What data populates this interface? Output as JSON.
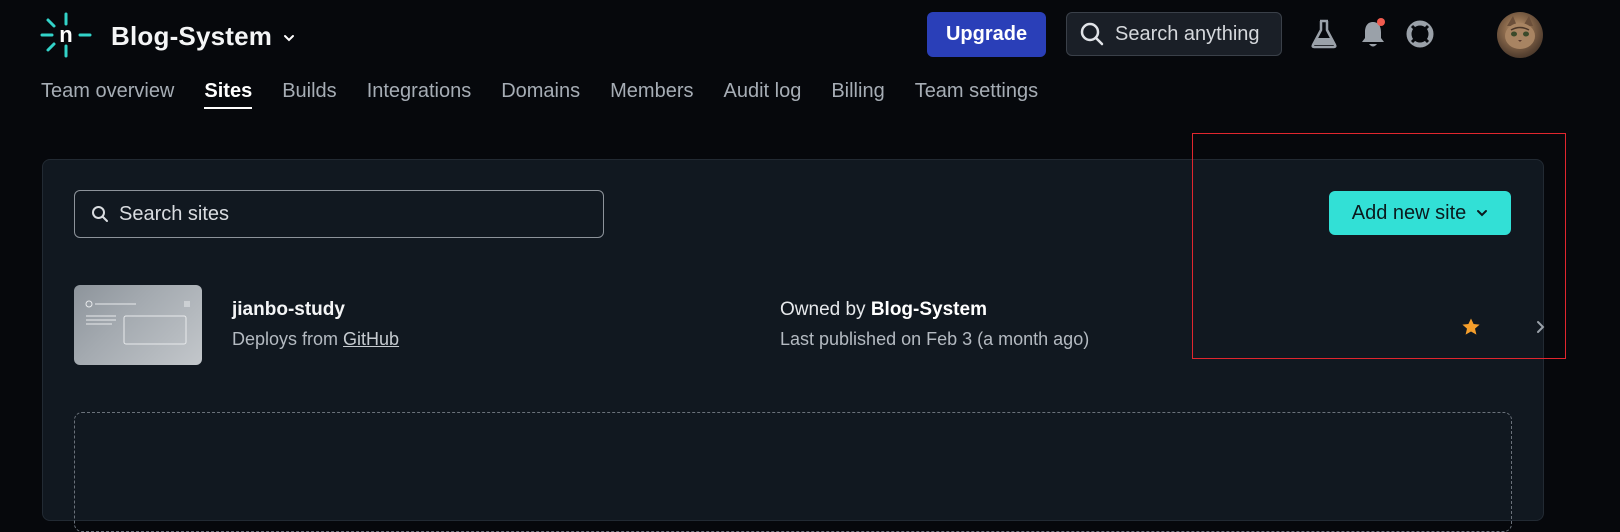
{
  "header": {
    "team_name": "Blog-System",
    "upgrade_label": "Upgrade",
    "search_placeholder": "Search anything"
  },
  "tabs": [
    {
      "label": "Team overview",
      "active": false
    },
    {
      "label": "Sites",
      "active": true
    },
    {
      "label": "Builds",
      "active": false
    },
    {
      "label": "Integrations",
      "active": false
    },
    {
      "label": "Domains",
      "active": false
    },
    {
      "label": "Members",
      "active": false
    },
    {
      "label": "Audit log",
      "active": false
    },
    {
      "label": "Billing",
      "active": false
    },
    {
      "label": "Team settings",
      "active": false
    }
  ],
  "sites_panel": {
    "search_placeholder": "Search sites",
    "add_site_label": "Add new site"
  },
  "site": {
    "name": "jianbo-study",
    "deploy_prefix": "Deploys from",
    "deploy_source": "GitHub",
    "owner_prefix": "Owned by",
    "owner": "Blog-System",
    "published": "Last published on Feb 3 (a month ago)",
    "favorite": true
  },
  "colors": {
    "upgrade": "#2a3fb8",
    "accent": "#32e0d6",
    "star": "#f59e2b",
    "highlight": "#e0262e"
  },
  "icons": [
    "logo-icon",
    "chevron-down-icon",
    "search-icon",
    "flask-icon",
    "bell-icon",
    "lifebuoy-icon",
    "star-icon",
    "chevron-right-icon"
  ]
}
